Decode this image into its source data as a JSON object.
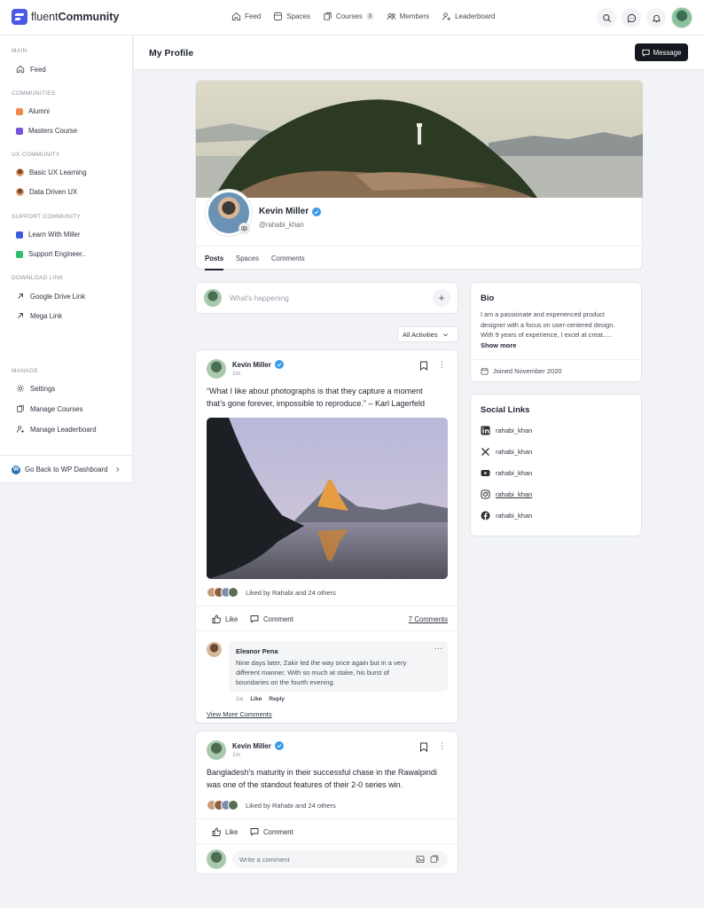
{
  "brand": {
    "light": "fluent",
    "bold": "Community"
  },
  "topnav": {
    "feed": "Feed",
    "spaces": "Spaces",
    "courses": "Courses",
    "courses_count": "3",
    "members": "Members",
    "leaderboard": "Leaderboard"
  },
  "sidebar": {
    "main_title": "MAIN",
    "feed": "Feed",
    "communities_title": "COMMUNITIES",
    "alumni": "Alumni",
    "masters": "Masters Course",
    "ux_title": "UX COMMUNITY",
    "basic_ux": "Basic UX Learning",
    "data_ux": "Data Driven UX",
    "support_title": "SUPPORT COMMUNITY",
    "learn": "Learn With Miller",
    "support_eng": "Support Engineer..",
    "download_title": "DOWNLOAD LINK",
    "gdrive": "Google Drive Link",
    "mega": "Mega Link",
    "manage_title": "MANAGE",
    "settings": "Settings",
    "manage_courses": "Manage Courses",
    "manage_leaderboard": "Manage Leaderboard",
    "wp": "Go Back to WP Dashboard"
  },
  "colors": {
    "alumni": "#f08a4b",
    "masters": "#7a52e0",
    "learn": "#3d5ae0",
    "support": "#2fbf71",
    "verified": "#3b9be8",
    "accent": "#15191f"
  },
  "page": {
    "title": "My Profile",
    "message_btn": "Message"
  },
  "profile": {
    "name": "Kevin Miller",
    "handle": "@rahabi_khan",
    "tabs": [
      "Posts",
      "Spaces",
      "Comments"
    ]
  },
  "composer": {
    "placeholder": "What's happening",
    "plus": "+"
  },
  "filter": {
    "label": "All Activities"
  },
  "post1": {
    "author": "Kevin Miller",
    "time": "1m",
    "text_line1": "“What I like about photographs is that they capture a moment",
    "text_line2": "that’s gone forever, impossible to reproduce.” – Karl Lagerfeld",
    "likes": "Liked by Rahabi and 24 others",
    "like": "Like",
    "comment": "Comment",
    "comments_count": "7 Comments",
    "comment_item": {
      "author": "Eleanor Pena",
      "line1": "Nine days later, Zakir led the way once again but in a very",
      "line2": "different manner. With so much at stake, his burst of",
      "line3": "boundaries on the fourth evening.",
      "time": "1w",
      "like": "Like",
      "reply": "Reply"
    },
    "view_more": "View More Comments"
  },
  "post2": {
    "author": "Kevin Miller",
    "time": "1m",
    "text_line1": "Bangladesh's maturity in their successful chase in the Rawalpindi",
    "text_line2": "was one of the standout features of their 2-0 series win.",
    "likes": "Liked by Rahabi and 24 others",
    "like": "Like",
    "comment": "Comment",
    "write_placeholder": "Write  a comment"
  },
  "bio": {
    "title": "Bio",
    "line1": "I am a passionate and experienced product",
    "line2": "designer with a focus on user-centered design.",
    "line3": "With 9 years of experience, I excel at creat.....",
    "show_more": "Show more",
    "joined": "Joined November 2020"
  },
  "social": {
    "title": "Social Links",
    "items": [
      {
        "icon": "linkedin-icon",
        "label": "rahabi_khan"
      },
      {
        "icon": "x-icon",
        "label": "rahabi_khan"
      },
      {
        "icon": "youtube-icon",
        "label": "rahabi_khan"
      },
      {
        "icon": "instagram-icon",
        "label": "rahabi_khan"
      },
      {
        "icon": "facebook-icon",
        "label": "rahabi_khan"
      }
    ]
  }
}
